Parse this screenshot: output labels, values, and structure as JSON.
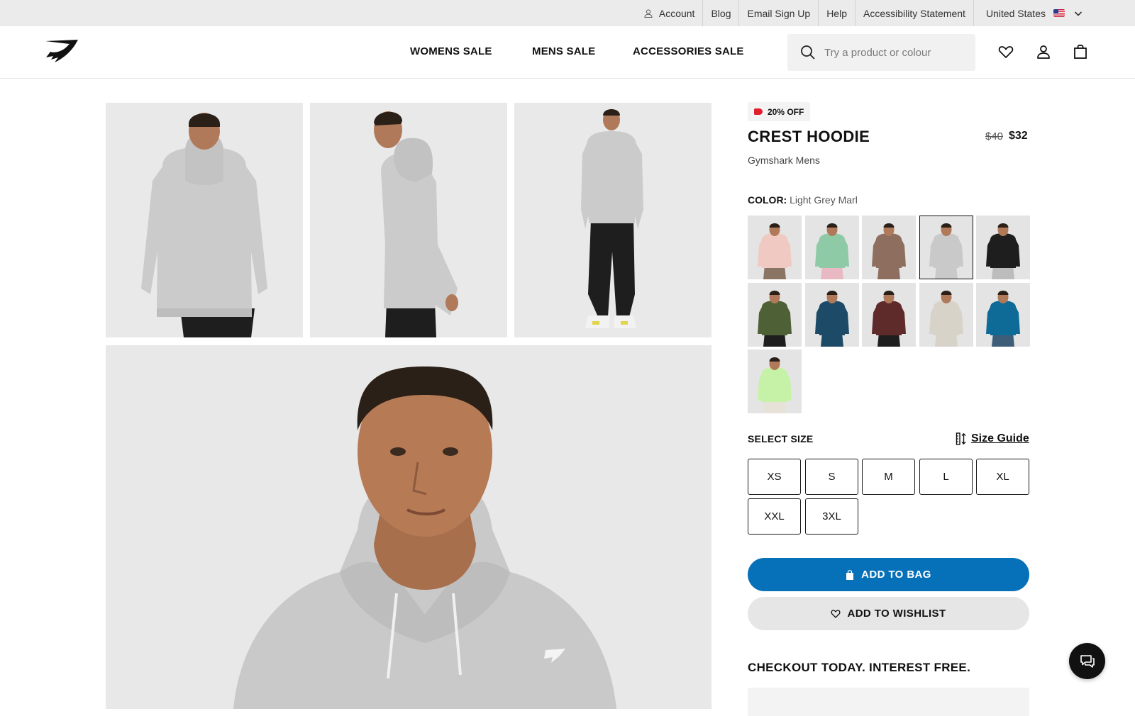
{
  "utility_bar": {
    "account": "Account",
    "blog": "Blog",
    "email_signup": "Email Sign Up",
    "help": "Help",
    "accessibility": "Accessibility Statement",
    "country": "United States"
  },
  "header": {
    "nav": [
      "WOMENS SALE",
      "MENS SALE",
      "ACCESSORIES SALE"
    ],
    "search_placeholder": "Try a product or colour"
  },
  "product": {
    "badge": "20% OFF",
    "title": "CREST HOODIE",
    "price_original": "$40",
    "price_sale": "$32",
    "subtitle": "Gymshark Mens",
    "color_label": "COLOR:",
    "color_value": "Light Grey Marl",
    "swatches": [
      {
        "name": "pink",
        "hoodie": "#f1c9c3",
        "pants": "#8a7565"
      },
      {
        "name": "green",
        "hoodie": "#8fcaa6",
        "pants": "#e9b9c3"
      },
      {
        "name": "brown",
        "hoodie": "#8e6e5e",
        "pants": "#8e6e5e"
      },
      {
        "name": "light-grey-marl",
        "hoodie": "#c9c9c9",
        "pants": "#c9c9c9",
        "selected": true
      },
      {
        "name": "black",
        "hoodie": "#1e1e1e",
        "pants": "#bcbcbc"
      },
      {
        "name": "olive",
        "hoodie": "#4e6136",
        "pants": "#1e1e1e"
      },
      {
        "name": "navy",
        "hoodie": "#1d4a66",
        "pants": "#1d4a66"
      },
      {
        "name": "maroon",
        "hoodie": "#5e2a2a",
        "pants": "#1e1e1e"
      },
      {
        "name": "sand",
        "hoodie": "#d8d3c9",
        "pants": "#d8d3c9"
      },
      {
        "name": "blue",
        "hoodie": "#0e6a96",
        "pants": "#3e5d78"
      },
      {
        "name": "lime",
        "hoodie": "#c6f2a8",
        "pants": "#e6e2d8"
      }
    ],
    "select_size_label": "SELECT SIZE",
    "size_guide_label": "Size Guide",
    "sizes": [
      "XS",
      "S",
      "M",
      "L",
      "XL",
      "XXL",
      "3XL"
    ],
    "add_to_bag": "ADD TO BAG",
    "add_to_wishlist": "ADD TO WISHLIST",
    "checkout_heading": "CHECKOUT TODAY. INTEREST FREE."
  },
  "colors": {
    "primary_blue": "#0670b8",
    "sale_red": "#e01e2e",
    "hoodie_grey": "#c9c9c9",
    "pants_black": "#1e1e1e"
  },
  "icons": [
    "user-icon",
    "flag-us-icon",
    "chevron-down-icon",
    "logo",
    "search-icon",
    "heart-icon",
    "account-icon",
    "bag-icon",
    "tag-icon",
    "size-guide-icon",
    "chat-icon"
  ]
}
